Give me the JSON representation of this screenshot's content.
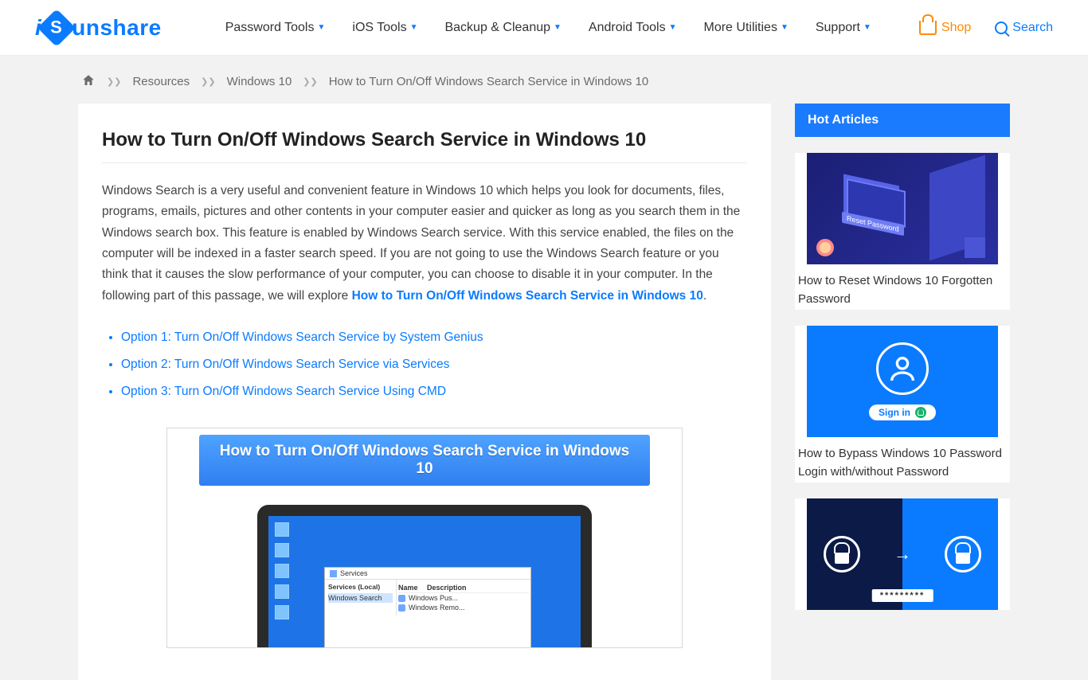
{
  "logo": {
    "prefix_i": "i",
    "suffix": "unshare",
    "mark": "S"
  },
  "nav": {
    "items": [
      "Password Tools",
      "iOS Tools",
      "Backup & Cleanup",
      "Android Tools",
      "More Utilities",
      "Support"
    ],
    "shop": "Shop",
    "search": "Search"
  },
  "breadcrumb": {
    "links": [
      "Resources",
      "Windows 10"
    ],
    "current": "How to Turn On/Off Windows Search Service in Windows 10"
  },
  "article": {
    "title": "How to Turn On/Off Windows Search Service in Windows 10",
    "intro_pre": "Windows Search is a very useful and convenient feature in Windows 10 which helps you look for documents, files, programs, emails, pictures and other contents in your computer easier and quicker as long as you search them in the Windows search box. This feature is enabled by Windows Search service. With this service enabled, the files on the computer will be indexed in a faster search speed. If you are not going to use the Windows Search feature or you think that it causes the slow performance of your computer, you can choose to disable it in your computer. In the following part of this passage, we will explore ",
    "intro_link": "How to Turn On/Off Windows Search Service in Windows 10",
    "intro_post": ".",
    "options": [
      "Option 1: Turn On/Off Windows Search Service by System Genius",
      "Option 2: Turn On/Off Windows Search Service via Services",
      "Option 3: Turn On/Off Windows Search Service Using CMD"
    ],
    "hero_banner": "How to Turn On/Off Windows Search Service in Windows 10",
    "services_window": {
      "title": "Services",
      "left_heading": "Services (Local)",
      "left_item": "Windows Search",
      "right_header": "Description",
      "rows": [
        "Windows Pus...",
        "Windows Remo..."
      ]
    }
  },
  "sidebar": {
    "heading": "Hot Articles",
    "items": [
      {
        "title": "How to Reset Windows 10 Forgotten Password",
        "badge": "Reset Password"
      },
      {
        "title": "How to Bypass Windows 10 Password Login with/without Password",
        "signin": "Sign in"
      },
      {
        "title_partial": "",
        "pw": "*********"
      }
    ]
  }
}
